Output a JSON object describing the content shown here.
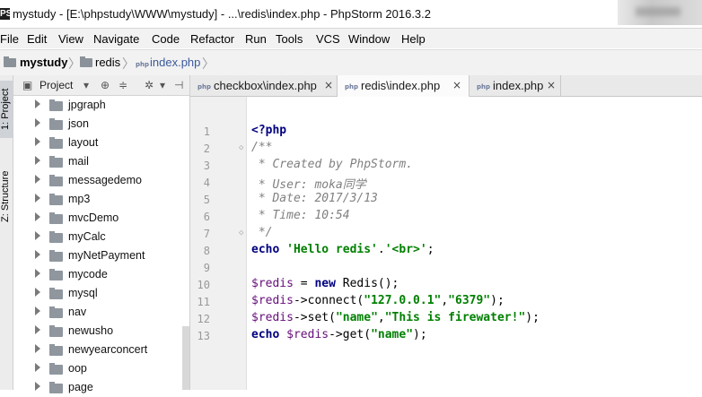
{
  "window": {
    "title": "mystudy - [E:\\phpstudy\\WWW\\mystudy] - ...\\redis\\index.php - PhpStorm 2016.3.2",
    "app_icon": "PS"
  },
  "menu": [
    "File",
    "Edit",
    "View",
    "Navigate",
    "Code",
    "Refactor",
    "Run",
    "Tools",
    "VCS",
    "Window",
    "Help"
  ],
  "breadcrumb": [
    "mystudy",
    "redis",
    "index.php"
  ],
  "sidebar_tabs": {
    "project": "1: Project",
    "structure": "Z: Structure"
  },
  "project_panel": {
    "view_label": "Project",
    "folders": [
      "jpgraph",
      "json",
      "layout",
      "mail",
      "messagedemo",
      "mp3",
      "mvcDemo",
      "myCalc",
      "myNetPayment",
      "mycode",
      "mysql",
      "nav",
      "newusho",
      "newyearconcert",
      "oop",
      "page"
    ]
  },
  "tabs": [
    {
      "label": "checkbox\\index.php",
      "active": false,
      "close": "×"
    },
    {
      "label": "redis\\index.php",
      "active": true,
      "close": "×"
    },
    {
      "label": "index.php",
      "active": false,
      "close": "×"
    }
  ],
  "editor": {
    "highlighted_line": 4,
    "lines": [
      [
        {
          "t": "<?php",
          "c": "kw"
        }
      ],
      [
        {
          "t": "/**",
          "c": "cm"
        }
      ],
      [
        {
          "t": " * Created by PhpStorm.",
          "c": "cm"
        }
      ],
      [
        {
          "t": " * User: moka同学",
          "c": "cm"
        }
      ],
      [
        {
          "t": " * Date: 2017/3/13",
          "c": "cm"
        }
      ],
      [
        {
          "t": " * Time: 10:54",
          "c": "cm"
        }
      ],
      [
        {
          "t": " */",
          "c": "cm"
        }
      ],
      [
        {
          "t": "echo ",
          "c": "kw"
        },
        {
          "t": "'Hello redis'",
          "c": "st"
        },
        {
          "t": ".",
          "c": ""
        },
        {
          "t": "'<br>'",
          "c": "st"
        },
        {
          "t": ";",
          "c": ""
        }
      ],
      [],
      [
        {
          "t": "$redis",
          "c": "vr"
        },
        {
          "t": " = ",
          "c": ""
        },
        {
          "t": "new ",
          "c": "kw"
        },
        {
          "t": "Redis();",
          "c": ""
        }
      ],
      [
        {
          "t": "$redis",
          "c": "vr"
        },
        {
          "t": "->connect(",
          "c": ""
        },
        {
          "t": "\"127.0.0.1\"",
          "c": "st"
        },
        {
          "t": ",",
          "c": ""
        },
        {
          "t": "\"6379\"",
          "c": "st"
        },
        {
          "t": ");",
          "c": ""
        }
      ],
      [
        {
          "t": "$redis",
          "c": "vr"
        },
        {
          "t": "->set(",
          "c": ""
        },
        {
          "t": "\"name\"",
          "c": "st"
        },
        {
          "t": ",",
          "c": ""
        },
        {
          "t": "\"This is firewater!\"",
          "c": "st"
        },
        {
          "t": ");",
          "c": ""
        }
      ],
      [
        {
          "t": "echo ",
          "c": "kw"
        },
        {
          "t": "$redis",
          "c": "vr"
        },
        {
          "t": "->get(",
          "c": ""
        },
        {
          "t": "\"name\"",
          "c": "st"
        },
        {
          "t": ");",
          "c": ""
        }
      ]
    ]
  }
}
